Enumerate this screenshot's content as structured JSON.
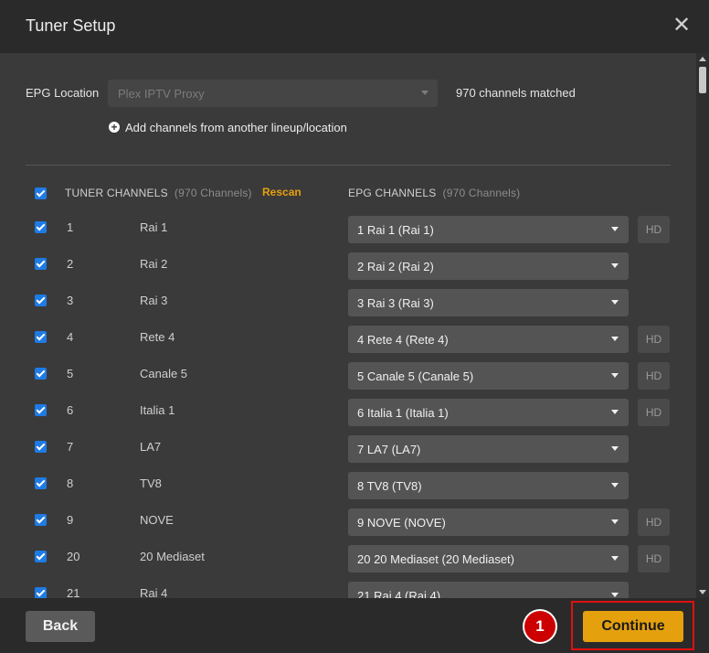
{
  "dialog": {
    "title": "Tuner Setup",
    "close_icon": "close-icon",
    "close_glyph": "✕"
  },
  "epg": {
    "label": "EPG Location",
    "location_value": "Plex IPTV Proxy",
    "matched_text": "970 channels matched",
    "add_link_label": "Add channels from another lineup/location",
    "add_icon": "plus-circle-icon",
    "add_glyph": "+"
  },
  "table_header": {
    "tuner_label": "TUNER CHANNELS",
    "tuner_count": "(970 Channels)",
    "rescan_label": "Rescan",
    "epg_label": "EPG CHANNELS",
    "epg_count": "(970 Channels)"
  },
  "rows": [
    {
      "num": "1",
      "name": "Rai 1",
      "epg": "1 Rai 1 (Rai 1)",
      "hd": "HD",
      "checked": true
    },
    {
      "num": "2",
      "name": "Rai 2",
      "epg": "2 Rai 2 (Rai 2)",
      "hd": "",
      "checked": true
    },
    {
      "num": "3",
      "name": "Rai 3",
      "epg": "3 Rai 3 (Rai 3)",
      "hd": "",
      "checked": true
    },
    {
      "num": "4",
      "name": "Rete 4",
      "epg": "4 Rete 4 (Rete 4)",
      "hd": "HD",
      "checked": true
    },
    {
      "num": "5",
      "name": "Canale 5",
      "epg": "5 Canale 5 (Canale 5)",
      "hd": "HD",
      "checked": true
    },
    {
      "num": "6",
      "name": "Italia 1",
      "epg": "6 Italia 1 (Italia 1)",
      "hd": "HD",
      "checked": true
    },
    {
      "num": "7",
      "name": "LA7",
      "epg": "7 LA7 (LA7)",
      "hd": "",
      "checked": true
    },
    {
      "num": "8",
      "name": "TV8",
      "epg": "8 TV8 (TV8)",
      "hd": "",
      "checked": true
    },
    {
      "num": "9",
      "name": "NOVE",
      "epg": "9 NOVE (NOVE)",
      "hd": "HD",
      "checked": true
    },
    {
      "num": "20",
      "name": "20 Mediaset",
      "epg": "20 20 Mediaset (20 Mediaset)",
      "hd": "HD",
      "checked": true
    },
    {
      "num": "21",
      "name": "Rai 4",
      "epg": "21 Rai 4 (Rai 4)",
      "hd": "",
      "checked": true
    }
  ],
  "footer": {
    "back_label": "Back",
    "continue_label": "Continue",
    "badge_number": "1"
  },
  "colors": {
    "accent": "#e5a00d",
    "checkbox": "#1e7be6",
    "annotation": "#cc0000"
  }
}
